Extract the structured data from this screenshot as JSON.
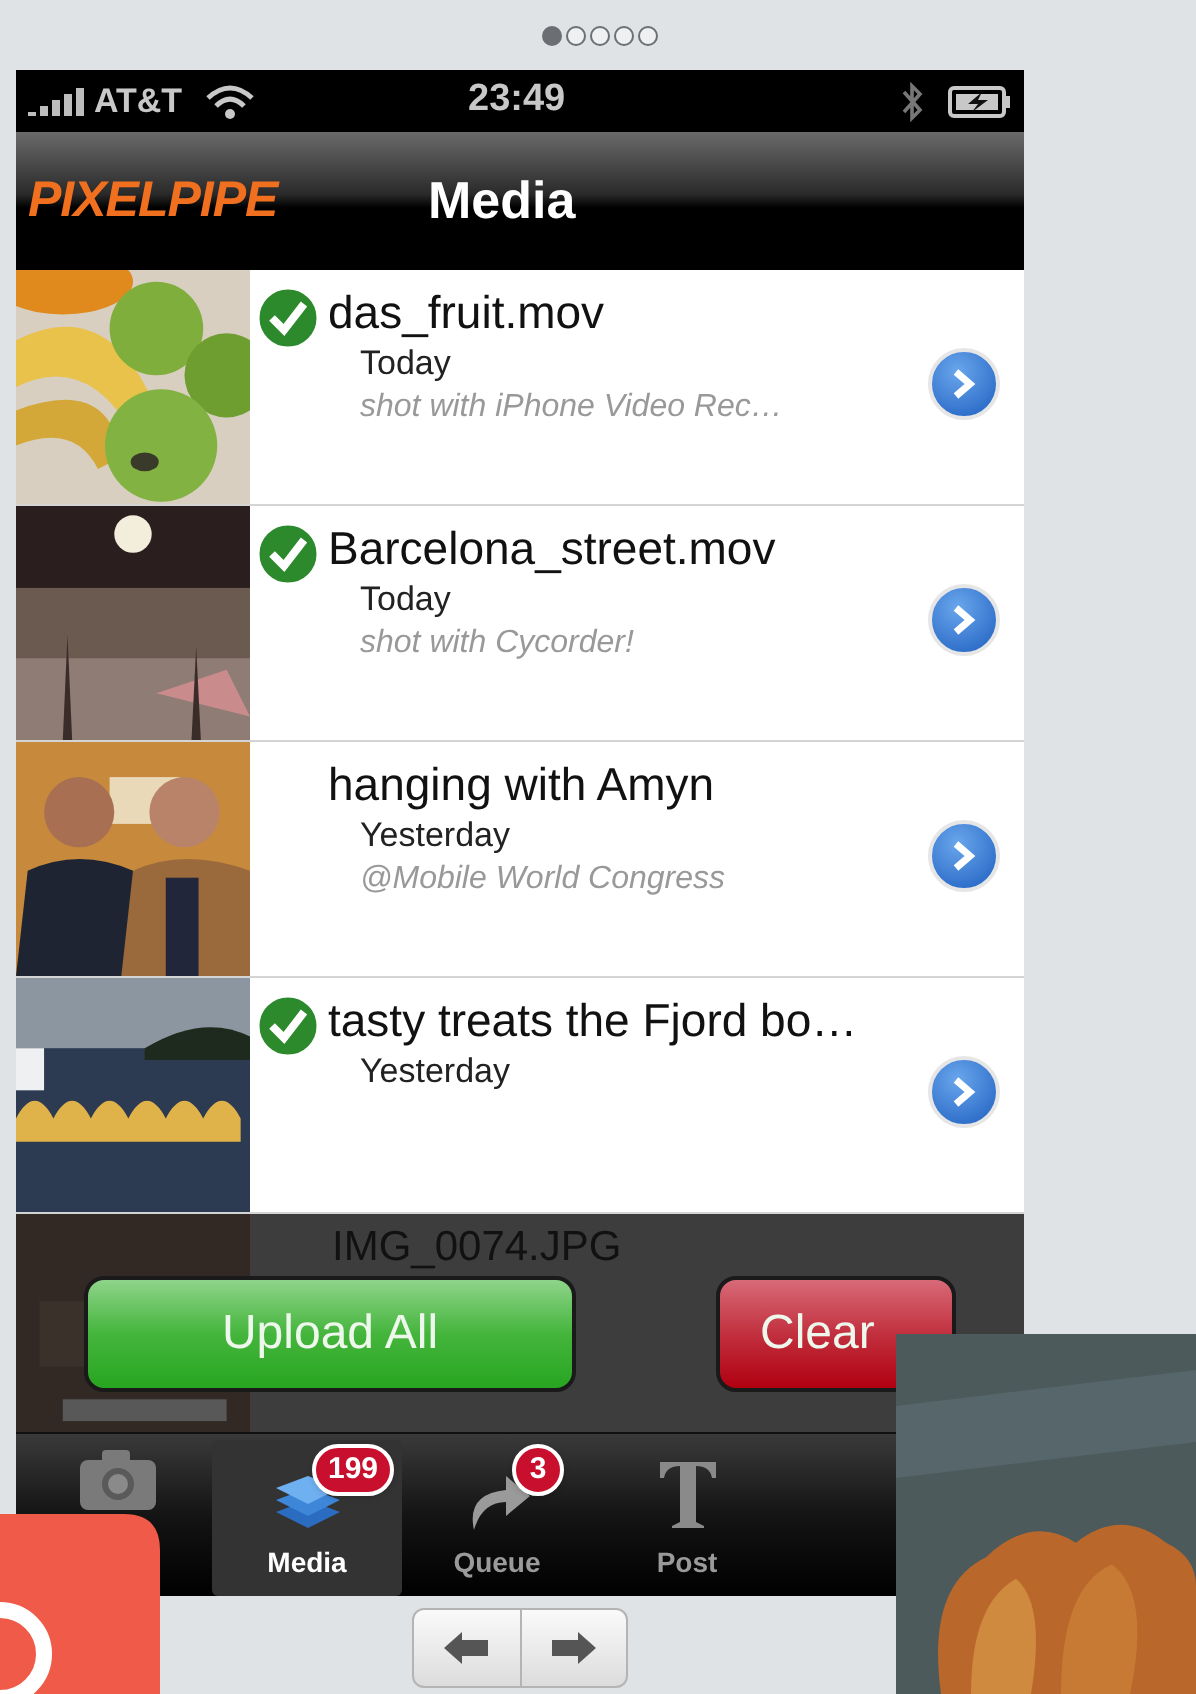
{
  "pager": [
    {
      "selected": true
    },
    {
      "selected": false
    },
    {
      "selected": false
    },
    {
      "selected": false
    },
    {
      "selected": false
    }
  ],
  "status_bar": {
    "carrier": "AT&T",
    "time": "23:49"
  },
  "nav_bar": {
    "logo": "PIXELPIPE",
    "title": "Media"
  },
  "media": [
    {
      "title": "das_fruit.mov",
      "date": "Today",
      "note": "shot with iPhone Video Rec…",
      "uploaded": true
    },
    {
      "title": "Barcelona_street.mov",
      "date": "Today",
      "note": "shot with Cycorder!",
      "uploaded": true
    },
    {
      "title": "hanging with Amyn",
      "date": "Yesterday",
      "note": "@Mobile World Congress",
      "uploaded": false
    },
    {
      "title": "tasty treats the Fjord bo…",
      "date": "Yesterday",
      "uploaded": true
    }
  ],
  "partial_row": {
    "title": "IMG_0074.JPG"
  },
  "actions": [
    {
      "label": "Upload All",
      "kind": "primary"
    },
    {
      "label": "Clear",
      "kind": "destructive"
    }
  ],
  "tab_bar": [
    {
      "kind": "camera",
      "selected": false
    },
    {
      "kind": "media",
      "label": "Media",
      "badge": "199",
      "selected": true
    },
    {
      "kind": "queue",
      "label": "Queue",
      "badge": "3",
      "selected": false
    },
    {
      "kind": "post",
      "label": "Post",
      "selected": false
    }
  ]
}
